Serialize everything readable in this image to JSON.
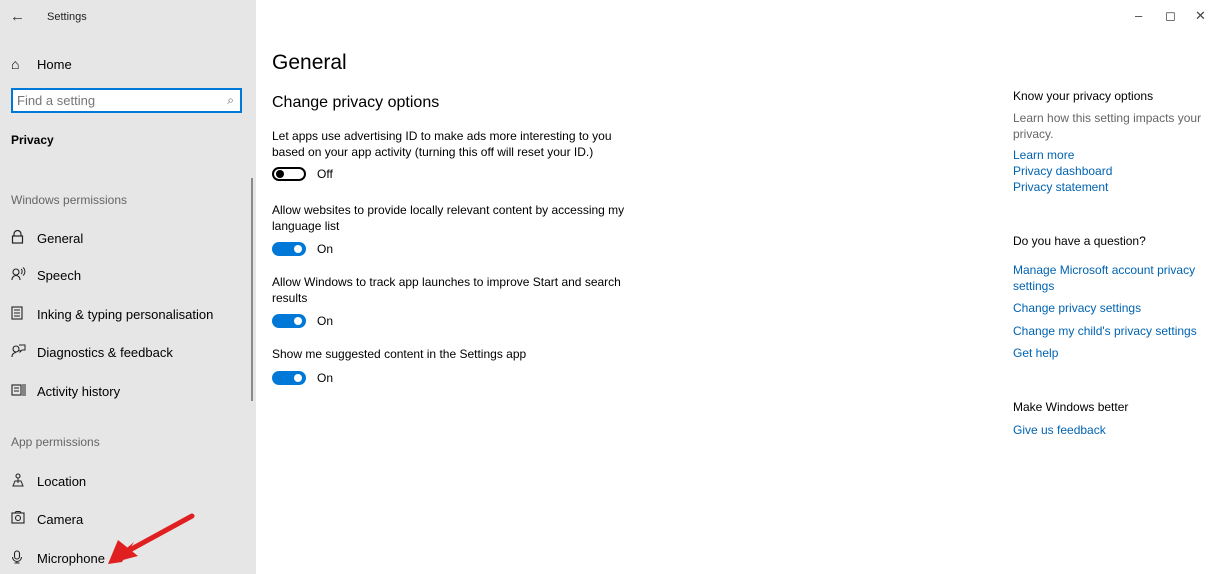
{
  "window": {
    "title": "Settings",
    "controls": {
      "minimize": "–",
      "maximize": "◻",
      "close": "✕"
    }
  },
  "sidebar": {
    "home": "Home",
    "search": {
      "placeholder": "Find a setting",
      "value": ""
    },
    "section": "Privacy",
    "group1": "Windows permissions",
    "items1": [
      {
        "label": "General",
        "icon": "lock-icon"
      },
      {
        "label": "Speech",
        "icon": "speech-icon"
      },
      {
        "label": "Inking & typing personalisation",
        "icon": "inking-icon"
      },
      {
        "label": "Diagnostics & feedback",
        "icon": "feedback-icon"
      },
      {
        "label": "Activity history",
        "icon": "activity-icon"
      }
    ],
    "group2": "App permissions",
    "items2": [
      {
        "label": "Location",
        "icon": "location-icon"
      },
      {
        "label": "Camera",
        "icon": "camera-icon"
      },
      {
        "label": "Microphone",
        "icon": "microphone-icon"
      }
    ]
  },
  "main": {
    "title": "General",
    "subtitle": "Change privacy options",
    "options": [
      {
        "desc": "Let apps use advertising ID to make ads more interesting to you based on your app activity (turning this off will reset your ID.)",
        "state": "Off"
      },
      {
        "desc": "Allow websites to provide locally relevant content by accessing my language list",
        "state": "On"
      },
      {
        "desc": "Allow Windows to track app launches to improve Start and search results",
        "state": "On"
      },
      {
        "desc": "Show me suggested content in the Settings app",
        "state": "On"
      }
    ]
  },
  "right": {
    "know_head": "Know your privacy options",
    "know_text": "Learn how this setting impacts your privacy.",
    "know_links": [
      "Learn more",
      "Privacy dashboard",
      "Privacy statement"
    ],
    "question_head": "Do you have a question?",
    "question_links": [
      "Manage Microsoft account privacy settings",
      "Change privacy settings",
      "Change my child's privacy settings",
      "Get help"
    ],
    "better_head": "Make Windows better",
    "better_links": [
      "Give us feedback"
    ]
  },
  "colors": {
    "accent": "#0078d7",
    "link": "#0063b1",
    "sidebar_bg": "#e6e6e6",
    "annotation": "#e02020"
  }
}
